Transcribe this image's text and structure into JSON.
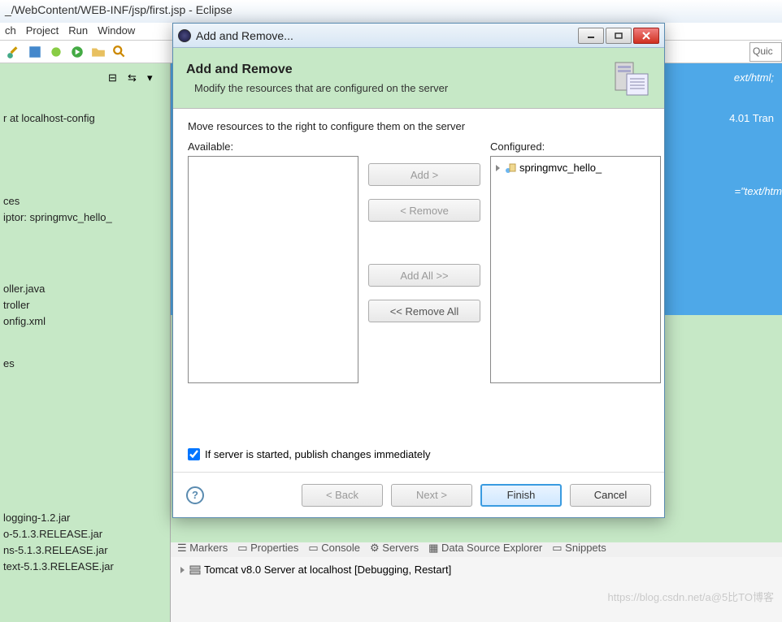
{
  "eclipse": {
    "title": "_/WebContent/WEB-INF/jsp/first.jsp - Eclipse",
    "menu": {
      "search": "ch",
      "project": "Project",
      "run": "Run",
      "window": "Window"
    },
    "quick": "Quic",
    "left_items": [
      "r at localhost-config",
      "ces",
      "iptor: springmvc_hello_",
      "oller.java",
      "troller",
      "onfig.xml",
      "es",
      "logging-1.2.jar",
      "o-5.1.3.RELEASE.jar",
      "ns-5.1.3.RELEASE.jar",
      "text-5.1.3.RELEASE.jar"
    ],
    "editor_lines": [
      "ext/html;",
      "4.01 Tran",
      "=\"text/htm"
    ],
    "bottom_tabs": [
      "Markers",
      "Properties",
      "Console",
      "Servers",
      "Data Source Explorer",
      "Snippets"
    ],
    "server_status": "Tomcat v8.0 Server at localhost  [Debugging, Restart]"
  },
  "dialog": {
    "window_title": "Add and Remove...",
    "header_title": "Add and Remove",
    "header_desc": "Modify the resources that are configured on the server",
    "instruction": "Move resources to the right to configure them on the server",
    "available_label": "Available:",
    "configured_label": "Configured:",
    "configured_items": [
      "springmvc_hello_"
    ],
    "btn_add": "Add >",
    "btn_remove": "< Remove",
    "btn_add_all": "Add All >>",
    "btn_remove_all": "<< Remove All",
    "checkbox_label": "If server is started, publish changes immediately",
    "checkbox_checked": true,
    "btn_back": "< Back",
    "btn_next": "Next >",
    "btn_finish": "Finish",
    "btn_cancel": "Cancel"
  },
  "watermark": "https://blog.csdn.net/a@5比TO博客"
}
